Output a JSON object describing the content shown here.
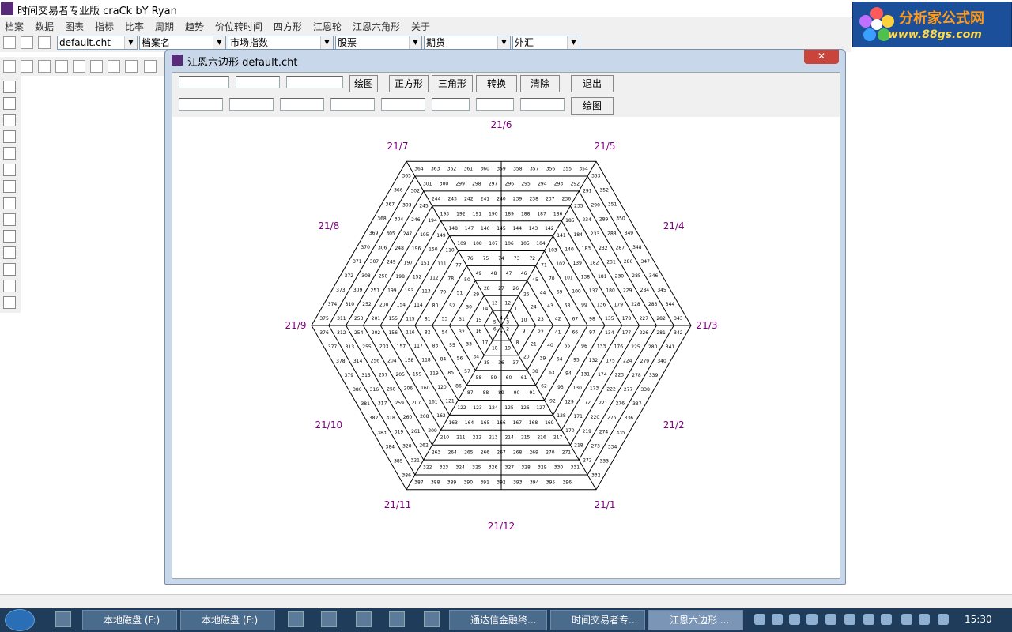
{
  "window": {
    "title": "时间交易者专业版 craCk bY Ryan"
  },
  "logo": {
    "main": "分析家公式网",
    "url": "www.88gs.com"
  },
  "menu": [
    "档案",
    "数据",
    "图表",
    "指标",
    "比率",
    "周期",
    "趋势",
    "价位转时间",
    "四方形",
    "江恩轮",
    "江恩六角形",
    "关于"
  ],
  "toolbar": {
    "file_combo": "default.cht",
    "name_combo": "档案名",
    "market_combo": "市场指数",
    "stock_combo": "股票",
    "futures_combo": "期货",
    "forex_combo": "外汇"
  },
  "dialog": {
    "title": "江恩六边形   default.cht",
    "buttons_row1": [
      "绘图",
      "正方形",
      "三角形",
      "转换",
      "清除",
      "退出"
    ],
    "button_row2": "绘图"
  },
  "chart_data": {
    "type": "gann-hexagon",
    "center_value": 1,
    "rings": 11,
    "max_value": 396,
    "direction_labels": [
      "21/1",
      "21/2",
      "21/3",
      "21/4",
      "21/5",
      "21/6",
      "21/7",
      "21/8",
      "21/9",
      "21/10",
      "21/11",
      "21/12"
    ],
    "label_color": "#800080",
    "line_color": "#000000"
  },
  "taskbar": {
    "items": [
      "本地磁盘 (F:)",
      "本地磁盘 (F:)",
      "通达信金融终...",
      "时间交易者专...",
      "江恩六边形   ..."
    ],
    "clock": "15:30"
  }
}
